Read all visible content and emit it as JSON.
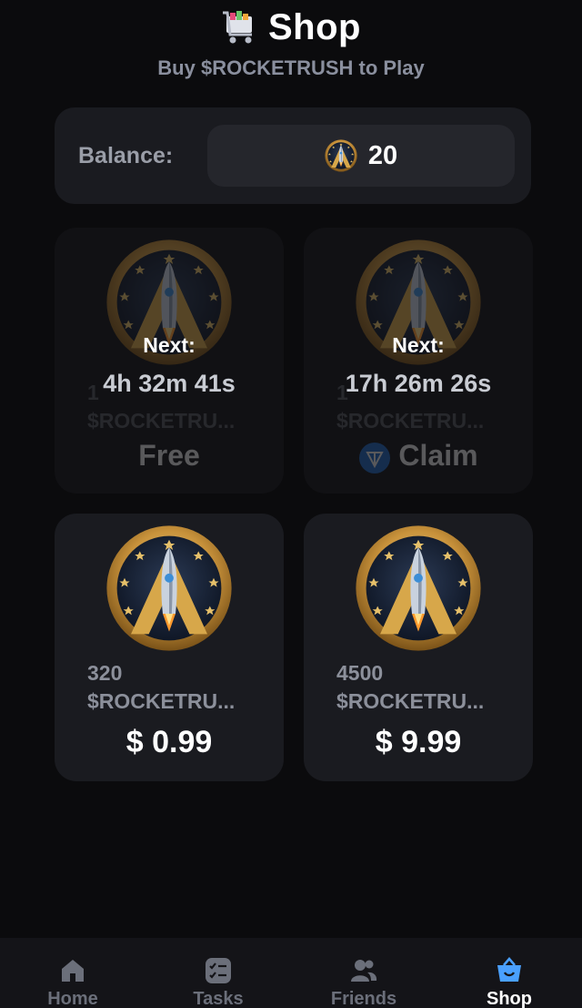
{
  "header": {
    "title": "Shop",
    "subtitle": "Buy $ROCKETRUSH to Play",
    "cart_icon": "shopping-cart-icon"
  },
  "balance": {
    "label": "Balance:",
    "value": "20",
    "coin_icon": "rocketrush-coin-icon"
  },
  "cards": [
    {
      "amount_line1": "1",
      "amount_line2": "$ROCKETRU...",
      "action": "Free",
      "next_label": "Next:",
      "countdown": "4h 32m 41s",
      "locked": true
    },
    {
      "amount_line1": "1",
      "amount_line2": "$ROCKETRU...",
      "action": "Claim",
      "action_icon": "ton-icon",
      "next_label": "Next:",
      "countdown": "17h 26m 26s",
      "locked": true
    },
    {
      "amount_line1": "320",
      "amount_line2": "$ROCKETRU...",
      "price": "$ 0.99"
    },
    {
      "amount_line1": "4500",
      "amount_line2": "$ROCKETRU...",
      "price": "$ 9.99"
    }
  ],
  "nav": [
    {
      "label": "Home",
      "icon": "home-icon",
      "active": false
    },
    {
      "label": "Tasks",
      "icon": "tasks-icon",
      "active": false
    },
    {
      "label": "Friends",
      "icon": "friends-icon",
      "active": false
    },
    {
      "label": "Shop",
      "icon": "shop-basket-icon",
      "active": true
    }
  ],
  "colors": {
    "background": "#0b0b0d",
    "card": "#1a1b20",
    "accent": "#4aa0ff",
    "coin_gold": "#d9a94a"
  }
}
